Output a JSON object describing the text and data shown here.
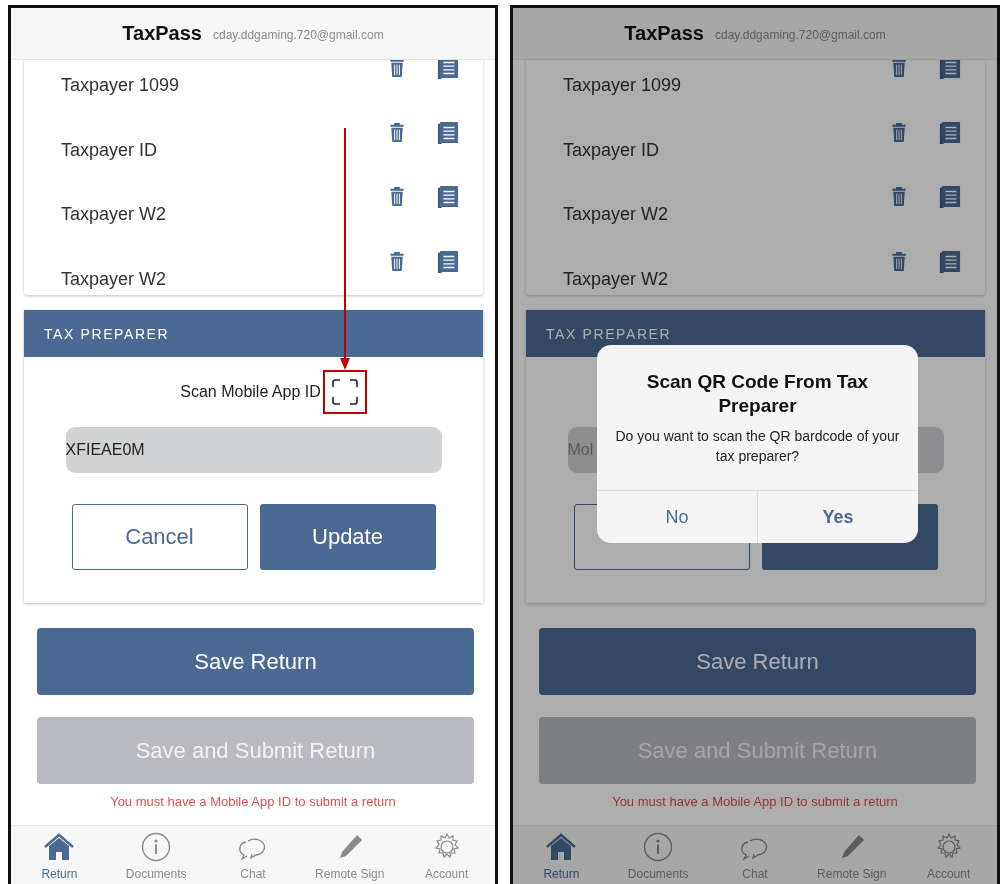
{
  "screens": [
    {
      "title": "TaxPass",
      "email": "cday.ddgaming.720@gmail.com",
      "documents": [
        {
          "name": "Taxpayer 1099"
        },
        {
          "name": "Taxpayer ID"
        },
        {
          "name": "Taxpayer W2"
        },
        {
          "name": "Taxpayer W2"
        }
      ],
      "section_title": "TAX PREPARER",
      "scan_label": "Scan Mobile App ID",
      "annotated": true,
      "field": {
        "value": "XFIEAE0M"
      },
      "buttons": [
        {
          "label": "Cancel",
          "kind": "outline"
        },
        {
          "label": "Update",
          "kind": "filled"
        }
      ],
      "actions": [
        {
          "label": "Save Return",
          "disabled": false
        },
        {
          "label": "Save and Submit Return",
          "disabled": true
        }
      ],
      "warning": "You must have a Mobile App ID to submit a return",
      "tabs": [
        {
          "label": "Return",
          "selected": true
        },
        {
          "label": "Documents",
          "selected": false
        },
        {
          "label": "Chat",
          "selected": false
        },
        {
          "label": "Remote Sign",
          "selected": false
        },
        {
          "label": "Account",
          "selected": false
        }
      ]
    },
    {
      "title": "TaxPass",
      "email": "cday.ddgaming.720@gmail.com",
      "documents": [
        {
          "name": "Taxpayer 1099"
        },
        {
          "name": "Taxpayer ID"
        },
        {
          "name": "Taxpayer W2"
        },
        {
          "name": "Taxpayer W2"
        }
      ],
      "section_title": "TAX PREPARER",
      "field": {
        "placeholder": "Mol"
      },
      "buttons": [
        {
          "kind": "outline"
        },
        {
          "kind": "filled"
        }
      ],
      "actions": [
        {
          "label": "Save Return",
          "disabled": false
        },
        {
          "label": "Save and Submit Return",
          "disabled": true
        }
      ],
      "warning": "You must have a Mobile App ID to submit a return",
      "tabs": [
        {
          "label": "Return",
          "selected": true
        },
        {
          "label": "Documents",
          "selected": false
        },
        {
          "label": "Chat",
          "selected": false
        },
        {
          "label": "Remote Sign",
          "selected": false
        },
        {
          "label": "Account",
          "selected": false
        }
      ],
      "dialog": {
        "title": "Scan QR Code From Tax Preparer",
        "message": "Do you want to scan the QR bardcode of your tax preparer?",
        "buttons": [
          {
            "label": "No",
            "primary": false
          },
          {
            "label": "Yes",
            "primary": true
          }
        ]
      }
    }
  ]
}
